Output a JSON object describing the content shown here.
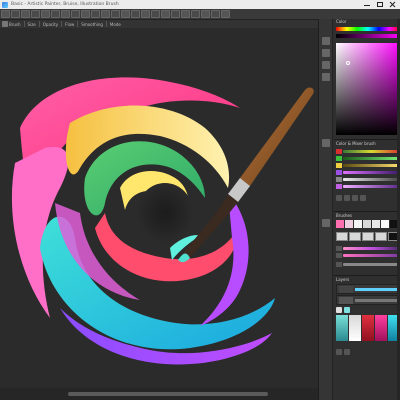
{
  "window": {
    "title": "Basic - Artistic Painter, Bruise, Illustration Brush"
  },
  "option_bar": {
    "items": [
      "Brush",
      "Size",
      "Opacity",
      "Flow",
      "Smoothing",
      "Mode"
    ]
  },
  "panels": {
    "color_title": "Color",
    "color_adjust_title": "Color & Mixer brush",
    "brushes_title": "Brushes",
    "layers_title": "Layers"
  },
  "colors": {
    "ui_background": "#2b2b2b",
    "panel_background": "#2f2f2f",
    "titlebar": "#ececec"
  },
  "icons": {
    "app": "app-icon",
    "minimize": "minimize-icon",
    "maximize": "maximize-icon",
    "close": "close-icon",
    "paintbrush": "paintbrush-icon"
  }
}
